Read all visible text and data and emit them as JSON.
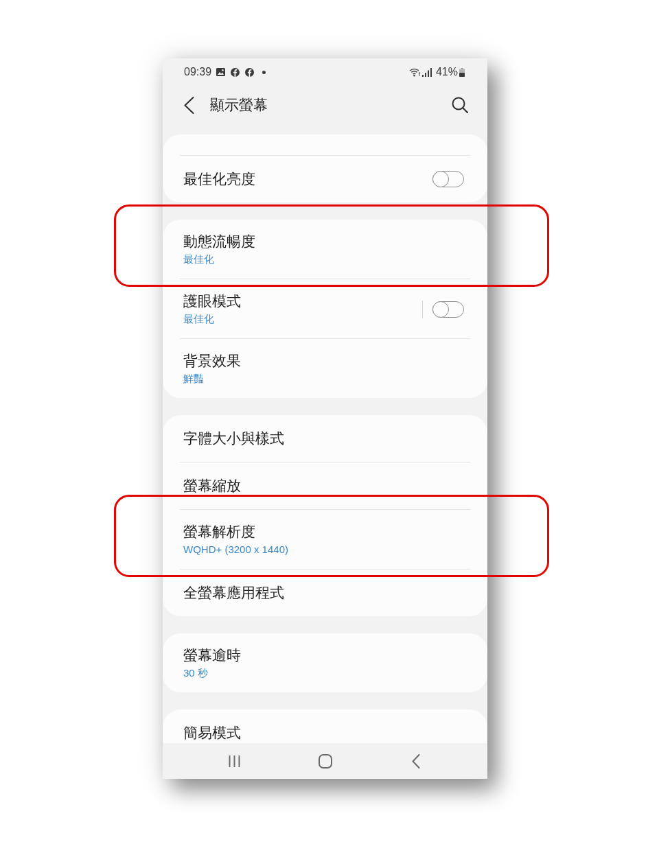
{
  "status_bar": {
    "time": "09:39",
    "battery": "41%"
  },
  "header": {
    "title": "顯示螢幕"
  },
  "groups": [
    {
      "clipped_top": true,
      "clipped_bottom": false,
      "rows": [
        {
          "kind": "toggle",
          "title": "最佳化亮度",
          "on": false,
          "highlighted": false
        }
      ]
    },
    {
      "clipped_top": false,
      "clipped_bottom": false,
      "rows": [
        {
          "kind": "link",
          "title": "動態流暢度",
          "subtitle": "最佳化",
          "highlighted": true
        },
        {
          "kind": "split_toggle",
          "title": "護眼模式",
          "subtitle": "最佳化",
          "on": false,
          "highlighted": false
        },
        {
          "kind": "link",
          "title": "背景效果",
          "subtitle": "鮮豔",
          "highlighted": false
        }
      ]
    },
    {
      "clipped_top": false,
      "clipped_bottom": false,
      "rows": [
        {
          "kind": "link",
          "title": "字體大小與樣式",
          "highlighted": false
        },
        {
          "kind": "link",
          "title": "螢幕縮放",
          "highlighted": false
        },
        {
          "kind": "link",
          "title": "螢幕解析度",
          "subtitle": "WQHD+ (3200 x 1440)",
          "highlighted": true
        },
        {
          "kind": "link",
          "title": "全螢幕應用程式",
          "highlighted": false
        }
      ]
    },
    {
      "clipped_top": false,
      "clipped_bottom": false,
      "rows": [
        {
          "kind": "link",
          "title": "螢幕逾時",
          "subtitle": "30 秒",
          "highlighted": false
        }
      ]
    },
    {
      "clipped_top": false,
      "clipped_bottom": true,
      "rows": [
        {
          "kind": "link",
          "title": "簡易模式",
          "highlighted": false
        }
      ]
    }
  ]
}
